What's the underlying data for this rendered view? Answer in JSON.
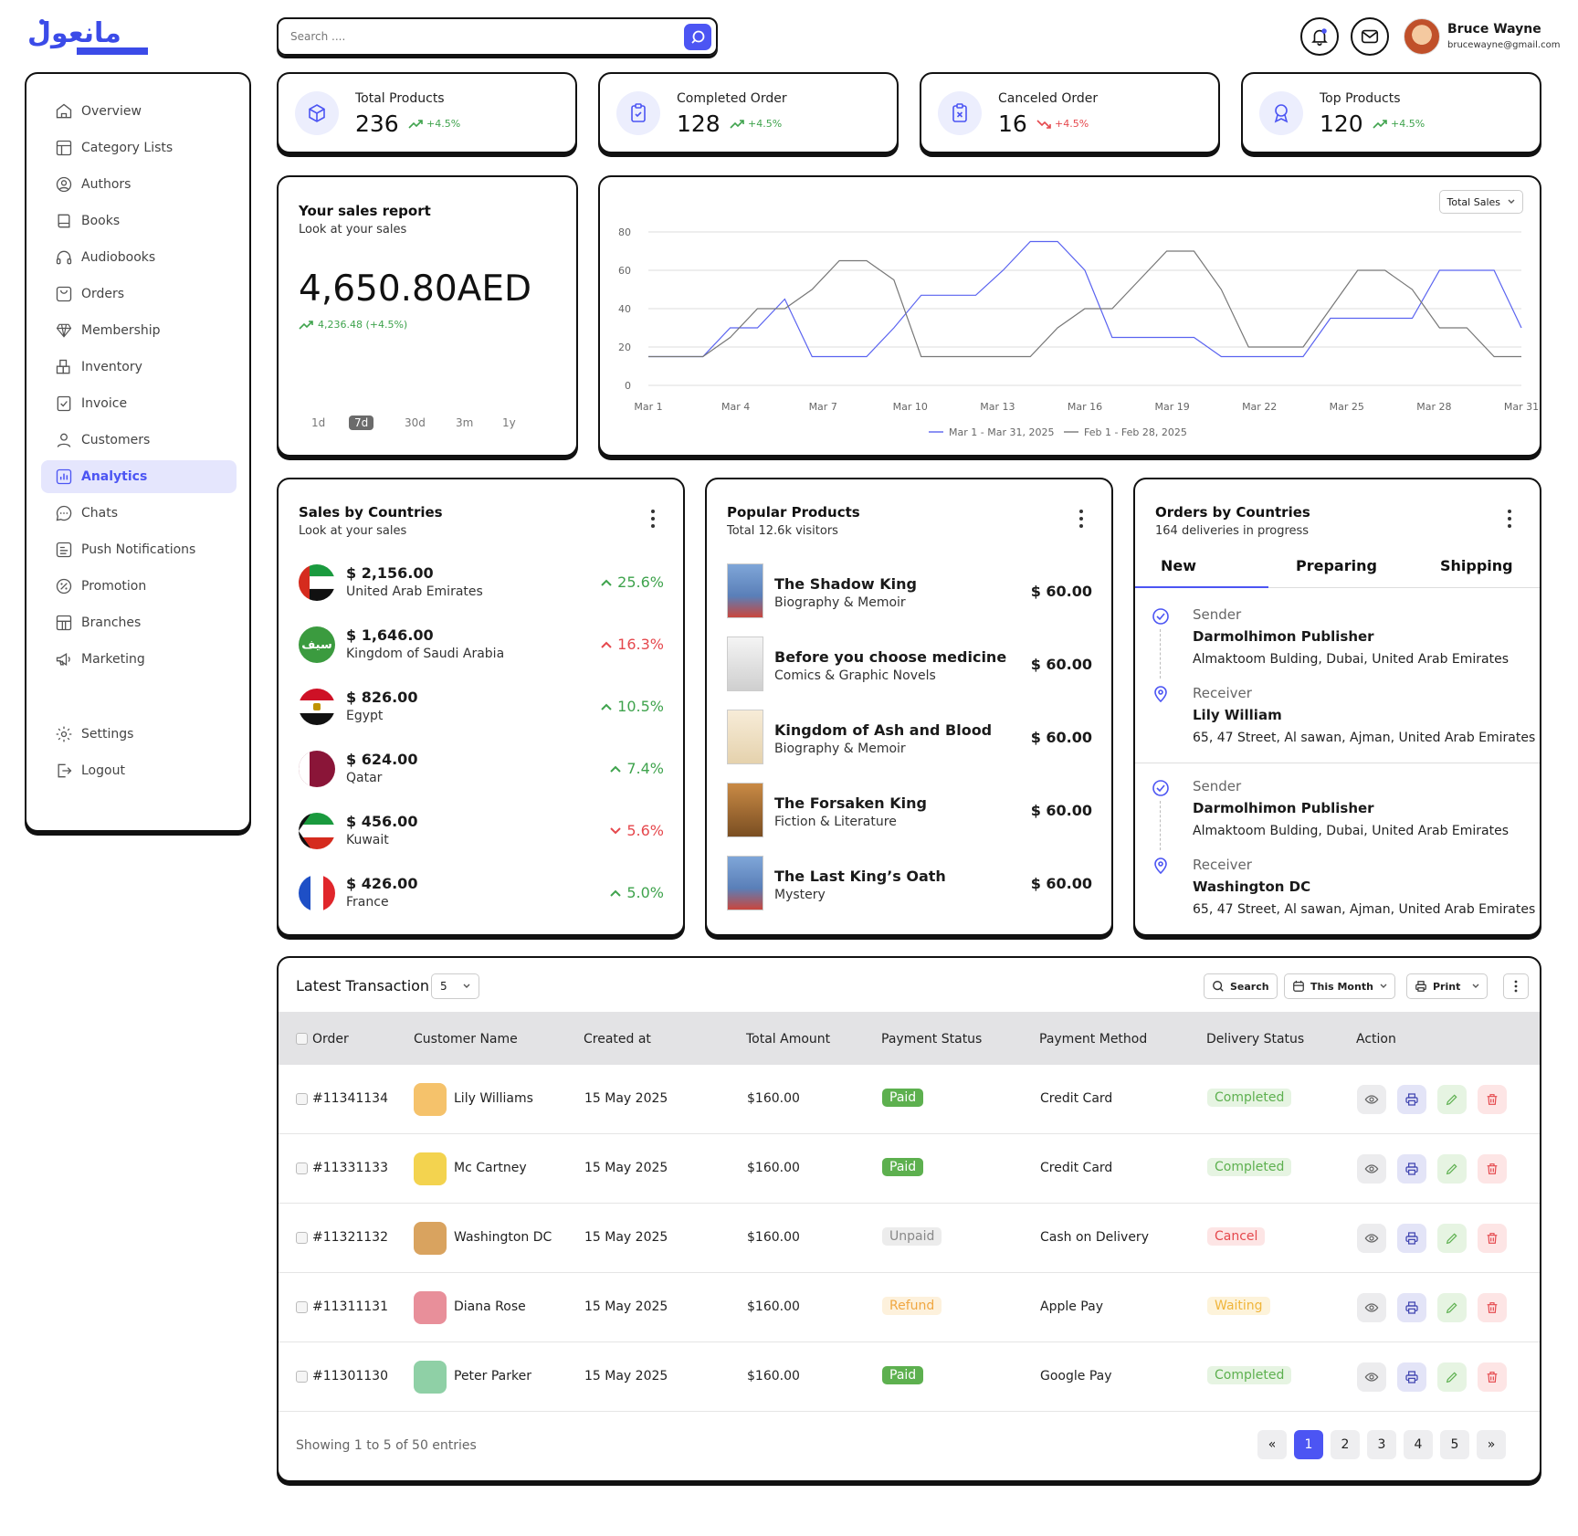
{
  "header": {
    "search_placeholder": "Search ....",
    "user_name": "Bruce Wayne",
    "user_email": "brucewayne@gmail.com"
  },
  "sidebar": {
    "items": [
      {
        "label": "Overview",
        "icon": "home-icon"
      },
      {
        "label": "Category Lists",
        "icon": "category-icon"
      },
      {
        "label": "Authors",
        "icon": "user-circle-icon"
      },
      {
        "label": "Books",
        "icon": "book-icon"
      },
      {
        "label": "Audiobooks",
        "icon": "headphones-icon"
      },
      {
        "label": "Orders",
        "icon": "orders-icon"
      },
      {
        "label": "Membership",
        "icon": "diamond-icon"
      },
      {
        "label": "Inventory",
        "icon": "inventory-icon"
      },
      {
        "label": "Invoice",
        "icon": "invoice-icon"
      },
      {
        "label": "Customers",
        "icon": "user-icon"
      },
      {
        "label": "Analytics",
        "icon": "chart-icon",
        "active": true
      },
      {
        "label": "Chats",
        "icon": "chat-icon"
      },
      {
        "label": "Push Notifications",
        "icon": "notification-icon"
      },
      {
        "label": "Promotion",
        "icon": "promotion-icon"
      },
      {
        "label": "Branches",
        "icon": "branch-icon"
      },
      {
        "label": "Marketing",
        "icon": "megaphone-icon"
      }
    ],
    "bottom": [
      {
        "label": "Settings",
        "icon": "gear-icon"
      },
      {
        "label": "Logout",
        "icon": "logout-icon"
      }
    ]
  },
  "stats": [
    {
      "label": "Total Products",
      "value": "236",
      "change": "+4.5%",
      "trend": "up",
      "icon": "box-icon"
    },
    {
      "label": "Completed Order",
      "value": "128",
      "change": "+4.5%",
      "trend": "up",
      "icon": "clipboard-check-icon"
    },
    {
      "label": "Canceled Order",
      "value": "16",
      "change": "+4.5%",
      "trend": "down",
      "icon": "clipboard-x-icon"
    },
    {
      "label": "Top Products",
      "value": "120",
      "change": "+4.5%",
      "trend": "up",
      "icon": "award-icon"
    }
  ],
  "sales_report": {
    "title": "Your sales report",
    "subtitle": "Look at your sales",
    "amount": "4,650.80AED",
    "change": "4,236.48 (+4.5%)",
    "ranges": [
      "1d",
      "7d",
      "30d",
      "3m",
      "1y"
    ],
    "active_range": "7d"
  },
  "sales_chart_dropdown": "Total Sales",
  "chart_data": {
    "type": "line",
    "x": [
      "Mar 1",
      "Mar 2",
      "Mar 3",
      "Mar 4",
      "Mar 5",
      "Mar 6",
      "Mar 7",
      "Mar 8",
      "Mar 9",
      "Mar 10",
      "Mar 11",
      "Mar 12",
      "Mar 13",
      "Mar 14",
      "Mar 15",
      "Mar 16",
      "Mar 17",
      "Mar 18",
      "Mar 19",
      "Mar 20",
      "Mar 21",
      "Mar 22",
      "Mar 23",
      "Mar 24",
      "Mar 25",
      "Mar 26",
      "Mar 27",
      "Mar 28",
      "Mar 29",
      "Mar 30",
      "Mar 31"
    ],
    "x_tick_labels": [
      "Mar 1",
      "Mar 4",
      "Mar 7",
      "Mar 10",
      "Mar 13",
      "Mar 16",
      "Mar 19",
      "Mar 22",
      "Mar 25",
      "Mar 28",
      "Mar 31"
    ],
    "ylim": [
      0,
      80
    ],
    "yticks": [
      0,
      20,
      40,
      60,
      80
    ],
    "grid": true,
    "legend_position": "bottom-center",
    "series": [
      {
        "name": "Mar 1 - Mar 31, 2025",
        "color": "#5a63f0",
        "values": [
          15,
          15,
          15,
          30,
          30,
          45,
          15,
          15,
          15,
          30,
          47,
          47,
          47,
          60,
          75,
          75,
          60,
          25,
          25,
          25,
          25,
          15,
          15,
          15,
          15,
          35,
          35,
          35,
          35,
          60,
          60,
          60,
          30
        ]
      },
      {
        "name": "Feb 1 - Feb 28, 2025",
        "color": "#777777",
        "values": [
          15,
          15,
          15,
          25,
          40,
          40,
          50,
          65,
          65,
          55,
          15,
          15,
          15,
          15,
          15,
          30,
          40,
          40,
          55,
          70,
          70,
          50,
          20,
          20,
          20,
          40,
          60,
          60,
          50,
          30,
          30,
          15,
          15
        ]
      }
    ]
  },
  "sales_by_countries": {
    "title": "Sales by Countries",
    "subtitle": "Look at your sales",
    "items": [
      {
        "amount": "$ 2,156.00",
        "country": "United Arab Emirates",
        "pct": "25.6%",
        "trend": "up"
      },
      {
        "amount": "$ 1,646.00",
        "country": "Kingdom of Saudi Arabia",
        "pct": "16.3%",
        "trend": "up-red"
      },
      {
        "amount": "$ 826.00",
        "country": "Egypt",
        "pct": "10.5%",
        "trend": "up"
      },
      {
        "amount": "$ 624.00",
        "country": "Qatar",
        "pct": "7.4%",
        "trend": "up"
      },
      {
        "amount": "$ 456.00",
        "country": "Kuwait",
        "pct": "5.6%",
        "trend": "down"
      },
      {
        "amount": "$ 426.00",
        "country": "France",
        "pct": "5.0%",
        "trend": "up"
      }
    ]
  },
  "popular_products": {
    "title": "Popular Products",
    "subtitle": "Total 12.6k visitors",
    "items": [
      {
        "title": "The Shadow King",
        "category": "Biography & Memoir",
        "price": "$ 60.00"
      },
      {
        "title": "Before you choose medicine",
        "category": "Comics & Graphic Novels",
        "price": "$ 60.00"
      },
      {
        "title": "Kingdom of Ash and Blood",
        "category": "Biography & Memoir",
        "price": "$ 60.00"
      },
      {
        "title": "The Forsaken King",
        "category": "Fiction & Literature",
        "price": "$ 60.00"
      },
      {
        "title": "The Last King’s Oath",
        "category": "Mystery",
        "price": "$ 60.00"
      }
    ]
  },
  "orders_by_countries": {
    "title": "Orders by Countries",
    "subtitle": "164 deliveries in progress",
    "tabs": [
      "New",
      "Preparing",
      "Shipping"
    ],
    "active_tab": "New",
    "deliveries": [
      {
        "sender_label": "Sender",
        "sender": "Darmolhimon Publisher",
        "sender_address": "Almaktoom Bulding, Dubai, United Arab Emirates",
        "receiver_label": "Receiver",
        "receiver": "Lily William",
        "receiver_address": "65, 47 Street, Al sawan, Ajman, United Arab Emirates"
      },
      {
        "sender_label": "Sender",
        "sender": "Darmolhimon Publisher",
        "sender_address": "Almaktoom Bulding, Dubai, United Arab Emirates",
        "receiver_label": "Receiver",
        "receiver": "Washington DC",
        "receiver_address": "65, 47 Street, Al sawan, Ajman, United Arab Emirates"
      }
    ]
  },
  "transactions": {
    "title": "Latest Transaction",
    "page_size": "5",
    "search_label": "Search",
    "period_label": "This Month",
    "print_label": "Print",
    "columns": [
      "Order",
      "Customer Name",
      "Created at",
      "Total Amount",
      "Payment Status",
      "Payment Method",
      "Delivery Status",
      "Action"
    ],
    "rows": [
      {
        "order": "#11341134",
        "customer": "Lily Williams",
        "created": "15 May 2025",
        "amount": "$160.00",
        "payment_status": "Paid",
        "payment_method": "Credit Card",
        "delivery_status": "Completed"
      },
      {
        "order": "#11331133",
        "customer": "Mc Cartney",
        "created": "15 May 2025",
        "amount": "$160.00",
        "payment_status": "Paid",
        "payment_method": "Credit Card",
        "delivery_status": "Completed"
      },
      {
        "order": "#11321132",
        "customer": "Washington DC",
        "created": "15 May 2025",
        "amount": "$160.00",
        "payment_status": "Unpaid",
        "payment_method": "Cash on Delivery",
        "delivery_status": "Cancel"
      },
      {
        "order": "#11311131",
        "customer": "Diana Rose",
        "created": "15 May 2025",
        "amount": "$160.00",
        "payment_status": "Refund",
        "payment_method": "Apple Pay",
        "delivery_status": "Waiting"
      },
      {
        "order": "#11301130",
        "customer": "Peter Parker",
        "created": "15 May 2025",
        "amount": "$160.00",
        "payment_status": "Paid",
        "payment_method": "Google Pay",
        "delivery_status": "Completed"
      }
    ],
    "footer": "Showing 1 to 5 of 50 entries",
    "pages": [
      "1",
      "2",
      "3",
      "4",
      "5"
    ],
    "active_page": "1",
    "first_label": "«",
    "last_label": "»"
  },
  "colors": {
    "accent": "#4c55f3",
    "up": "#3fa34d",
    "down": "#e5484d"
  }
}
